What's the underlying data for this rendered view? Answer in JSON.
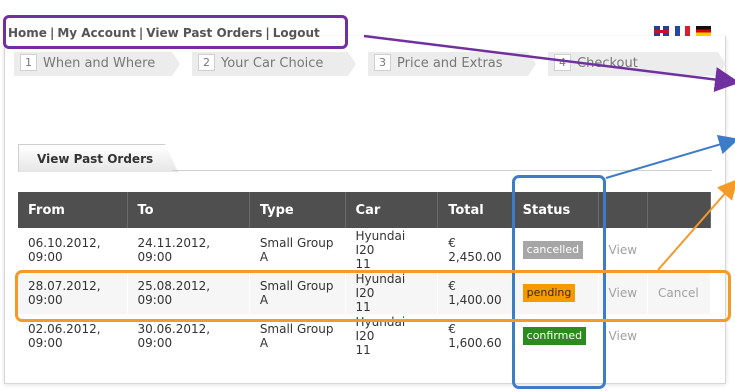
{
  "nav": {
    "home": "Home",
    "sep": "|",
    "account": "My Account",
    "past_orders": "View Past Orders",
    "logout": "Logout"
  },
  "steps": [
    {
      "num": "1",
      "label": "When and Where"
    },
    {
      "num": "2",
      "label": "Your Car Choice"
    },
    {
      "num": "3",
      "label": "Price and Extras"
    },
    {
      "num": "4",
      "label": "Checkout"
    }
  ],
  "section_title": "View Past Orders",
  "table": {
    "headers": [
      "From",
      "To",
      "Type",
      "Car",
      "Total",
      "Status",
      "",
      ""
    ],
    "rows": [
      {
        "from_date": "06.10.2012,",
        "from_time": "09:00",
        "to_date": "24.11.2012,",
        "to_time": "09:00",
        "type_1": "Small Group",
        "type_2": "A",
        "car_1": "Hyundai I20",
        "car_2": "11",
        "total_cur": "€",
        "total_amt": "2,450.00",
        "status": "cancelled",
        "view": "View",
        "cancel": ""
      },
      {
        "from_date": "28.07.2012,",
        "from_time": "09:00",
        "to_date": "25.08.2012,",
        "to_time": "09:00",
        "type_1": "Small Group",
        "type_2": "A",
        "car_1": "Hyundai I20",
        "car_2": "11",
        "total_cur": "€",
        "total_amt": "1,400.00",
        "status": "pending",
        "view": "View",
        "cancel": "Cancel"
      },
      {
        "from_date": "02.06.2012,",
        "from_time": "09:00",
        "to_date": "30.06.2012,",
        "to_time": "09:00",
        "type_1": "Small Group",
        "type_2": "A",
        "car_1": "Hyundai I20",
        "car_2": "11",
        "total_cur": "€",
        "total_amt": "1,600.60",
        "status": "confirmed",
        "view": "View",
        "cancel": ""
      }
    ]
  },
  "colors": {
    "nav_highlight": "#7030a0",
    "status_highlight": "#3f7cc7",
    "row_highlight": "#f39a2b",
    "cancelled": "#a6a6a6",
    "pending": "#f59b00",
    "confirmed": "#2d8a1e"
  },
  "icons": [
    "flag-uk-icon",
    "flag-fr-icon",
    "flag-de-icon"
  ]
}
